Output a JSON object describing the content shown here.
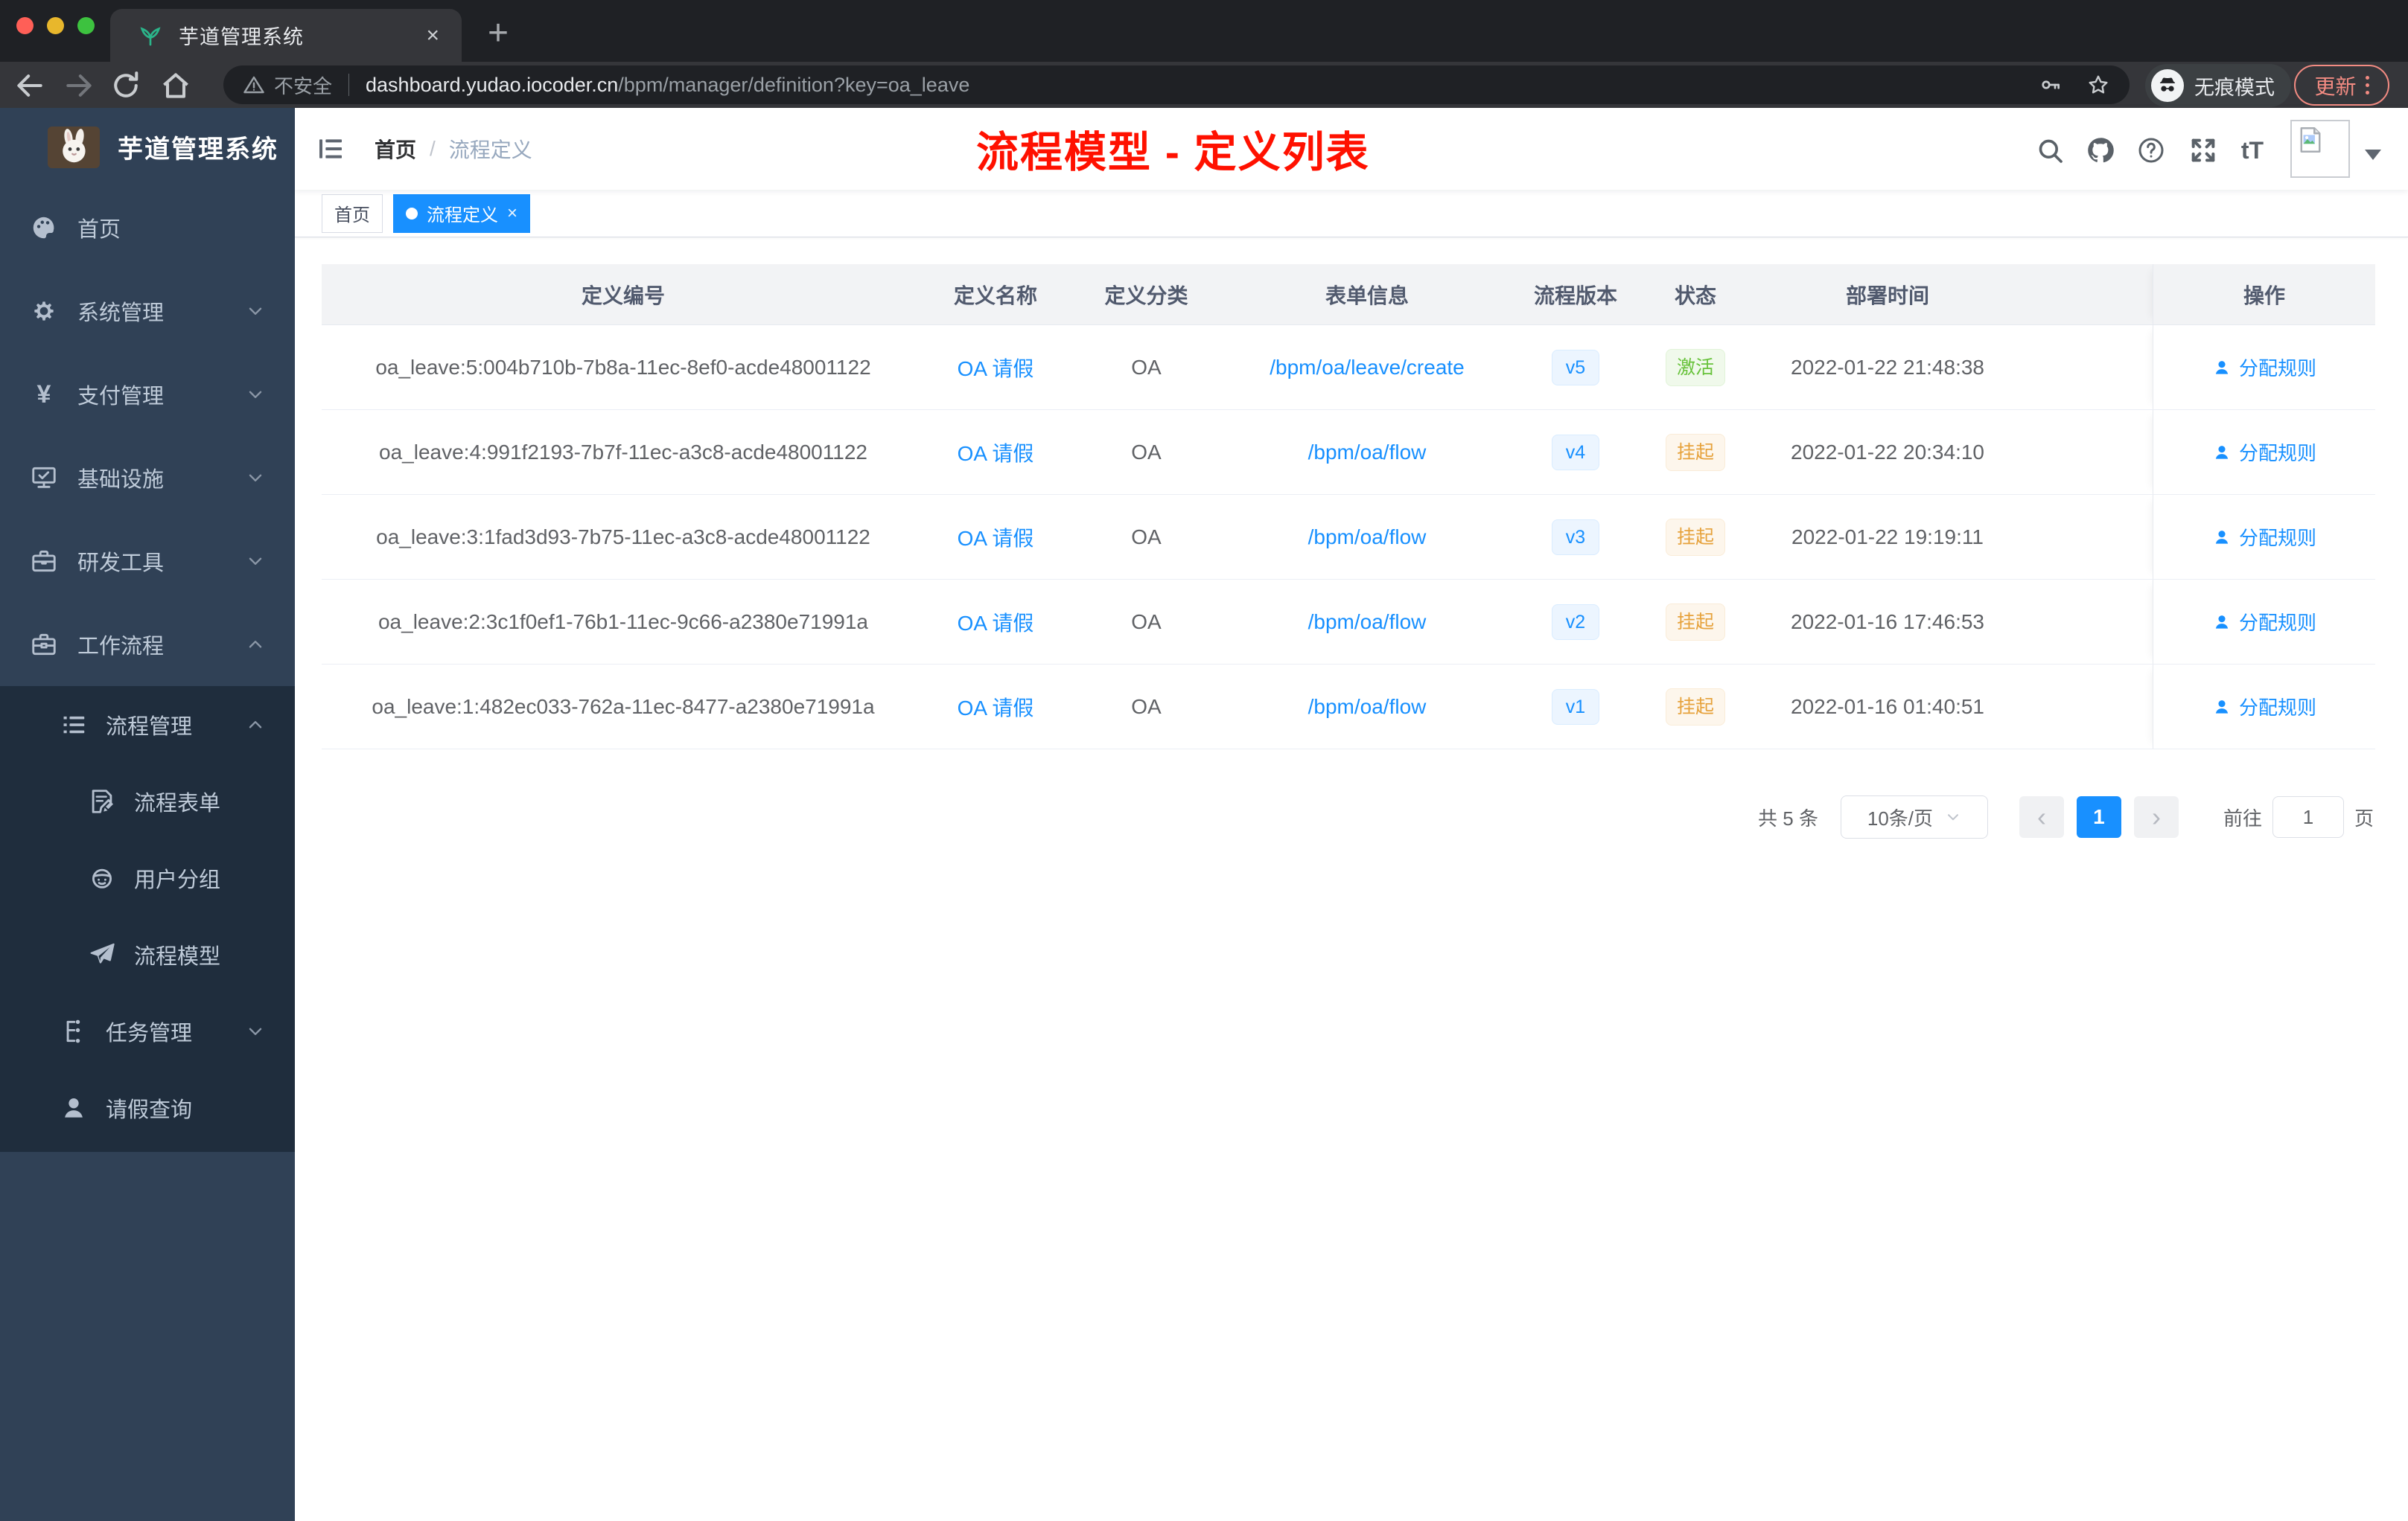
{
  "colors": {
    "accent": "#1890ff",
    "status_green": "#67c23a",
    "status_orange": "#e6a23c",
    "annotation_red": "#ff1100",
    "sidebar_bg": "#304156",
    "submenu_bg": "#1f2d3d"
  },
  "browser": {
    "tab_title": "芋道管理系统",
    "security_label": "不安全",
    "url_host": "dashboard.yudao.iocoder.cn",
    "url_path": "/bpm/manager/definition?key=oa_leave",
    "incognito_label": "无痕模式",
    "update_label": "更新"
  },
  "glyphs": {
    "close": "×",
    "plus": "+",
    "prev": "‹",
    "next": "›",
    "font_size": "tT",
    "yen": "¥"
  },
  "sidebar": {
    "logo_title": "芋道管理系统",
    "items": [
      {
        "label": "首页",
        "icon": "dashboard-icon",
        "level": 1,
        "chevron": "",
        "dark": false
      },
      {
        "label": "系统管理",
        "icon": "gear-icon",
        "level": 1,
        "chevron": "down",
        "dark": false
      },
      {
        "label": "支付管理",
        "icon": "yen-icon",
        "level": 1,
        "chevron": "down",
        "dark": false
      },
      {
        "label": "基础设施",
        "icon": "monitor-icon",
        "level": 1,
        "chevron": "down",
        "dark": false
      },
      {
        "label": "研发工具",
        "icon": "toolbox-icon",
        "level": 1,
        "chevron": "down",
        "dark": false
      },
      {
        "label": "工作流程",
        "icon": "briefcase-icon",
        "level": 1,
        "chevron": "up",
        "dark": false
      },
      {
        "label": "流程管理",
        "icon": "list-tree-icon",
        "level": 2,
        "chevron": "up",
        "dark": true
      },
      {
        "label": "流程表单",
        "icon": "form-edit-icon",
        "level": 3,
        "chevron": "",
        "dark": true
      },
      {
        "label": "用户分组",
        "icon": "user-group-icon",
        "level": 3,
        "chevron": "",
        "dark": true
      },
      {
        "label": "流程模型",
        "icon": "paper-plane-icon",
        "level": 3,
        "chevron": "",
        "dark": true
      },
      {
        "label": "任务管理",
        "icon": "task-tree-icon",
        "level": 2,
        "chevron": "down",
        "dark": true
      },
      {
        "label": "请假查询",
        "icon": "person-icon",
        "level": 2,
        "chevron": "",
        "dark": true
      }
    ]
  },
  "header": {
    "breadcrumb_home": "首页",
    "breadcrumb_separator": "/",
    "breadcrumb_current": "流程定义",
    "annotation": "流程模型 - 定义列表"
  },
  "tags": [
    {
      "label": "首页",
      "active": false,
      "closable": false
    },
    {
      "label": "流程定义",
      "active": true,
      "closable": true
    }
  ],
  "table": {
    "columns": [
      "定义编号",
      "定义名称",
      "定义分类",
      "表单信息",
      "流程版本",
      "状态",
      "部署时间",
      "操作"
    ],
    "rows": [
      {
        "id": "oa_leave:5:004b710b-7b8a-11ec-8ef0-acde48001122",
        "name": "OA 请假",
        "category": "OA",
        "form": "/bpm/oa/leave/create",
        "version": "v5",
        "status": "激活",
        "status_type": "active",
        "time": "2022-01-22 21:48:38",
        "action": "分配规则"
      },
      {
        "id": "oa_leave:4:991f2193-7b7f-11ec-a3c8-acde48001122",
        "name": "OA 请假",
        "category": "OA",
        "form": "/bpm/oa/flow",
        "version": "v4",
        "status": "挂起",
        "status_type": "suspend",
        "time": "2022-01-22 20:34:10",
        "action": "分配规则"
      },
      {
        "id": "oa_leave:3:1fad3d93-7b75-11ec-a3c8-acde48001122",
        "name": "OA 请假",
        "category": "OA",
        "form": "/bpm/oa/flow",
        "version": "v3",
        "status": "挂起",
        "status_type": "suspend",
        "time": "2022-01-22 19:19:11",
        "action": "分配规则"
      },
      {
        "id": "oa_leave:2:3c1f0ef1-76b1-11ec-9c66-a2380e71991a",
        "name": "OA 请假",
        "category": "OA",
        "form": "/bpm/oa/flow",
        "version": "v2",
        "status": "挂起",
        "status_type": "suspend",
        "time": "2022-01-16 17:46:53",
        "action": "分配规则"
      },
      {
        "id": "oa_leave:1:482ec033-762a-11ec-8477-a2380e71991a",
        "name": "OA 请假",
        "category": "OA",
        "form": "/bpm/oa/flow",
        "version": "v1",
        "status": "挂起",
        "status_type": "suspend",
        "time": "2022-01-16 01:40:51",
        "action": "分配规则"
      }
    ]
  },
  "pagination": {
    "total": "共 5 条",
    "page_size": "10条/页",
    "current_page": "1",
    "goto_label": "前往",
    "goto_value": "1",
    "page_unit": "页"
  }
}
